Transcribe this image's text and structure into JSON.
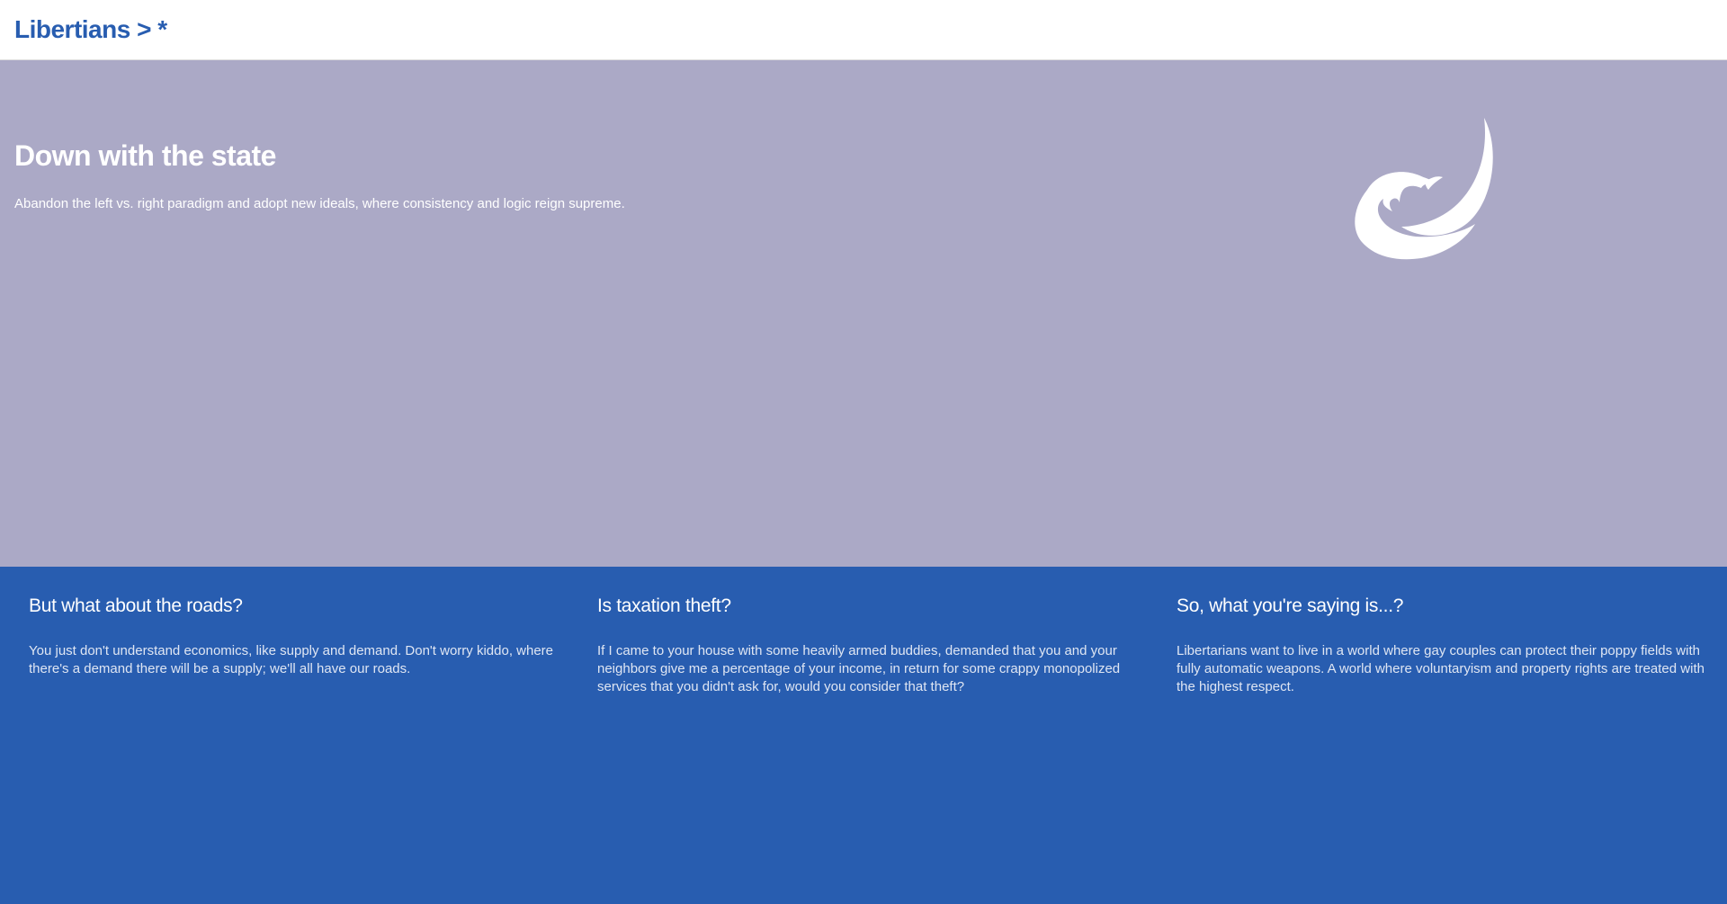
{
  "header": {
    "title": "Libertians > *"
  },
  "hero": {
    "heading": "Down with the state",
    "subtext": "Abandon the left vs. right paradigm and adopt new ideals, where consistency and logic reign supreme.",
    "logo_icon": "eagle-icon"
  },
  "features": [
    {
      "heading": "But what about the roads?",
      "text": "You just don't understand economics, like supply and demand. Don't worry kiddo, where there's a demand there will be a supply; we'll all have our roads."
    },
    {
      "heading": "Is taxation theft?",
      "text": "If I came to your house with some heavily armed buddies, demanded that you and your neighbors give me a percentage of your income, in return for some crappy monopolized services that you didn't ask for, would you consider that theft?"
    },
    {
      "heading": "So, what you're saying is...?",
      "text": "Libertarians want to live in a world where gay couples can protect their poppy fields with fully automatic weapons. A world where voluntaryism and property rights are treated with the highest respect."
    }
  ],
  "colors": {
    "brand_blue": "#285db0",
    "hero_bg": "#aba9c6",
    "header_bg": "#ffffff"
  }
}
